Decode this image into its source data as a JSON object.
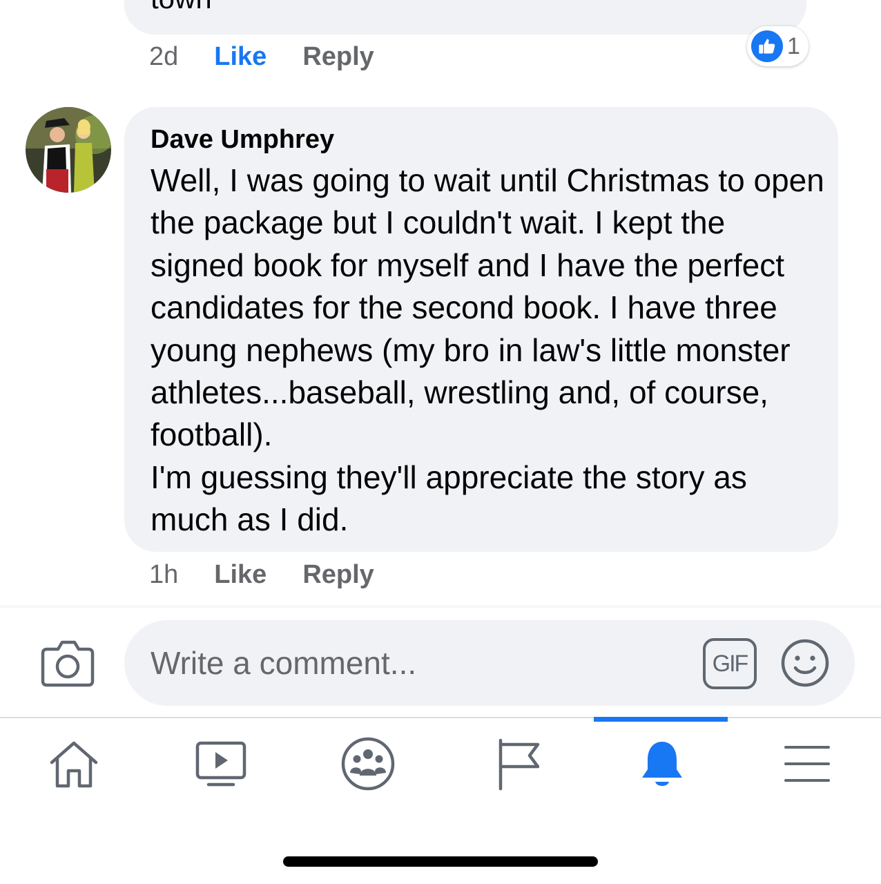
{
  "previous_comment": {
    "text_tail": "town",
    "time": "2d",
    "like_label": "Like",
    "reply_label": "Reply",
    "reaction_count": "1"
  },
  "comment": {
    "author": "Dave Umphrey",
    "text": "Well, I was going to wait until Christmas to open the package but I couldn't wait. I kept the signed book for myself and I have the perfect candidates for the second book. I have three young nephews (my bro in law's little monster athletes...baseball, wrestling and, of course, football).\nI'm guessing they'll appreciate the story as much as I did.",
    "time": "1h",
    "like_label": "Like",
    "reply_label": "Reply"
  },
  "composer": {
    "placeholder": "Write a comment...",
    "gif_label": "GIF"
  },
  "tabs": [
    {
      "name": "home",
      "icon": "home-icon",
      "active": false
    },
    {
      "name": "watch",
      "icon": "video-play-icon",
      "active": false
    },
    {
      "name": "groups",
      "icon": "groups-icon",
      "active": false
    },
    {
      "name": "pages",
      "icon": "flag-icon",
      "active": false
    },
    {
      "name": "notifications",
      "icon": "bell-icon",
      "active": true
    },
    {
      "name": "menu",
      "icon": "hamburger-menu-icon",
      "active": false
    }
  ],
  "colors": {
    "accent": "#1877f2",
    "bubble": "#f0f2f5",
    "secondary_text": "#65676b"
  }
}
